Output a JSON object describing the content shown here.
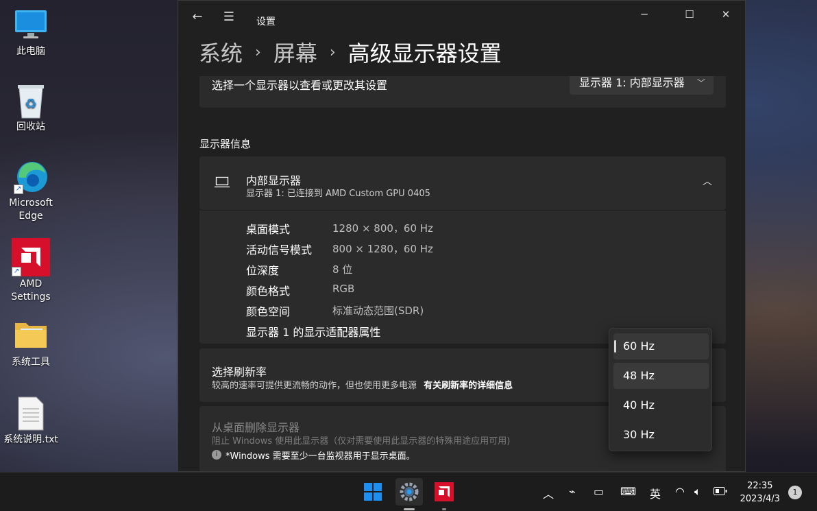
{
  "desktop": {
    "icons": [
      {
        "label": "此电脑"
      },
      {
        "label": "回收站"
      },
      {
        "label": "Microsoft Edge"
      },
      {
        "label": "AMD Settings"
      },
      {
        "label": "系统工具"
      },
      {
        "label": "系统说明.txt"
      }
    ]
  },
  "window": {
    "title": "设置",
    "breadcrumb": [
      "系统",
      "屏幕",
      "高级显示器设置"
    ],
    "select_display": {
      "label": "选择一个显示器以查看或更改其设置",
      "value": "显示器 1: 内部显示器"
    },
    "section_title": "显示器信息",
    "display_card": {
      "name": "内部显示器",
      "subtitle": "显示器 1: 已连接到 AMD Custom GPU 0405",
      "rows": [
        {
          "label": "桌面模式",
          "value": "1280 × 800，60 Hz"
        },
        {
          "label": "活动信号模式",
          "value": "800 × 1280，60 Hz"
        },
        {
          "label": "位深度",
          "value": "8 位"
        },
        {
          "label": "颜色格式",
          "value": "RGB"
        },
        {
          "label": "颜色空间",
          "value": "标准动态范围(SDR)"
        }
      ],
      "adapter_link": "显示器 1 的显示适配器属性"
    },
    "refresh": {
      "title": "选择刷新率",
      "desc": "较高的速率可提供更流畅的动作，但也使用更多电源",
      "link": "有关刷新率的详细信息",
      "options": [
        "60 Hz",
        "48 Hz",
        "40 Hz",
        "30 Hz"
      ],
      "selected": "60 Hz"
    },
    "remove": {
      "title": "从桌面删除显示器",
      "desc": "阻止 Windows 使用此显示器（仅对需要使用此显示器的特殊用途应用可用)",
      "note": "*Windows 需要至少一台监视器用于显示桌面。"
    }
  },
  "taskbar": {
    "ime": "英",
    "time": "22:35",
    "date": "2023/4/3",
    "notifications": "1"
  },
  "colors": {
    "window_bg": "#202020",
    "card_bg": "#2b2b2b",
    "amd_red": "#d6102b",
    "win_blue": "#1d8ff2"
  }
}
